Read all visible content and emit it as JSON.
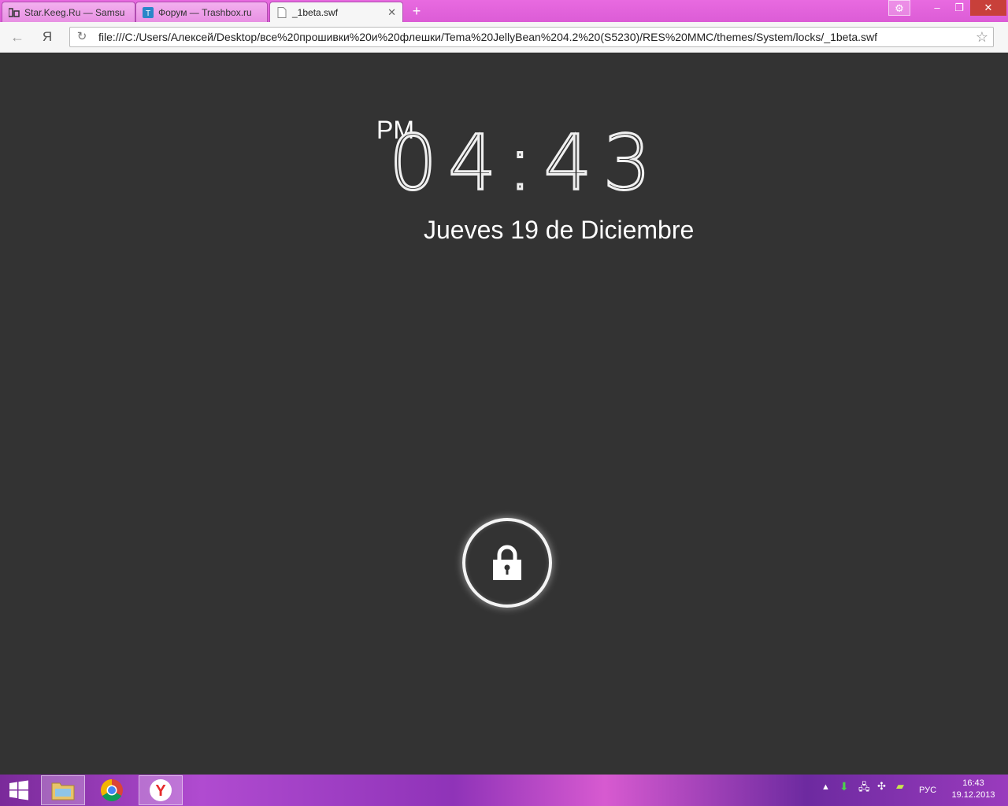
{
  "browser": {
    "tabs": [
      {
        "label": "Star.Keeg.Ru — Samsu",
        "icon": "site-icon"
      },
      {
        "label": "Форум — Trashbox.ru",
        "icon": "trashbox-icon"
      },
      {
        "label": "_1beta.swf",
        "icon": "page-icon"
      }
    ],
    "new_tab": "+",
    "url": "file:///C:/Users/Алексей/Desktop/все%20прошивки%20и%20флешки/Tema%20JellyBean%204.2%20(S5230)/RES%20MMC/themes/System/locks/_1beta.swf",
    "yandex_label": "Я",
    "back": "←",
    "reload": "↻",
    "star": "☆"
  },
  "lockscreen": {
    "ampm": "PM",
    "time": "04:43",
    "date": "Jueves 19 de Diciembre",
    "lock_icon": "padlock-icon"
  },
  "taskbar": {
    "language": "РУС",
    "time": "16:43",
    "date": "19.12.2013"
  }
}
